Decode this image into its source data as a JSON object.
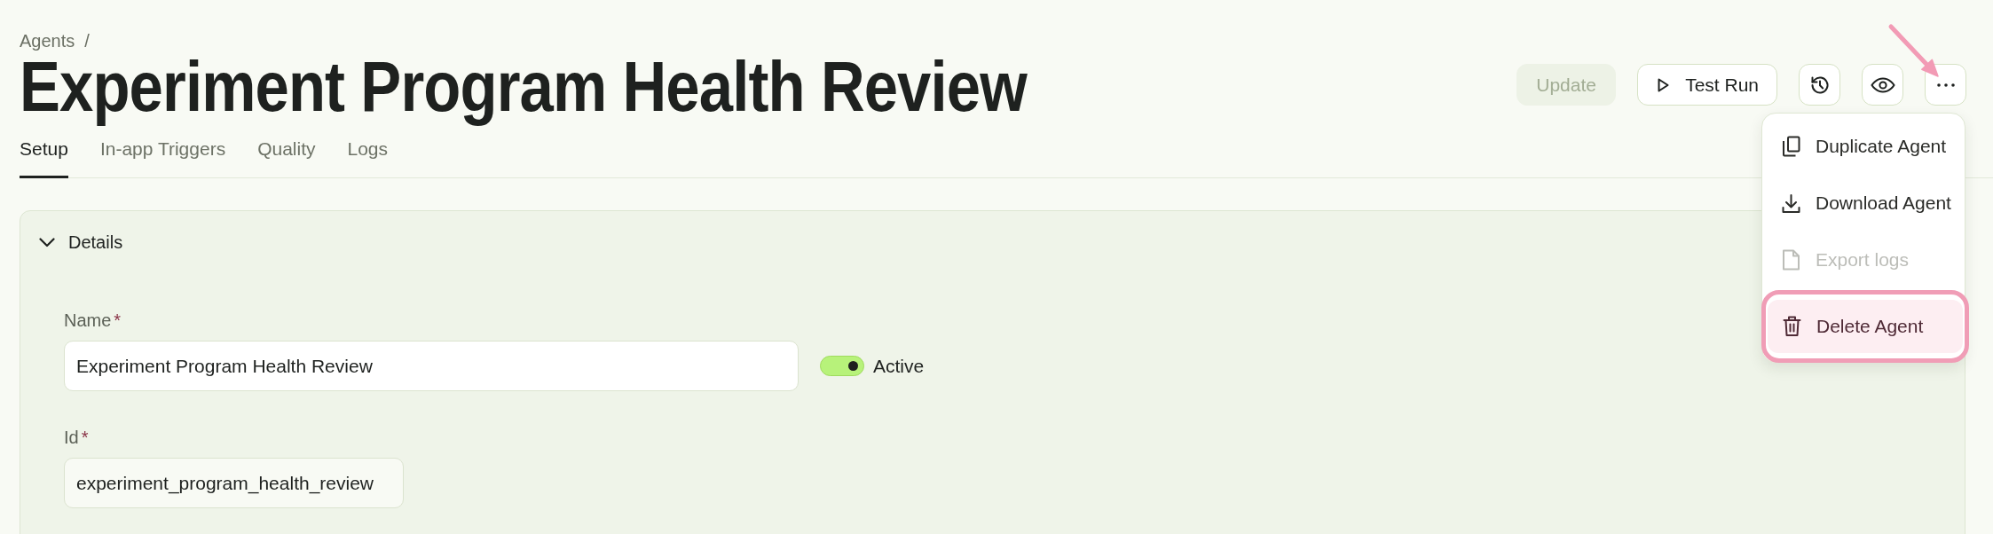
{
  "breadcrumb": {
    "parent": "Agents",
    "separator": "/"
  },
  "title": "Experiment Program Health Review",
  "actions": [
    {
      "kind": "update",
      "label": "Update",
      "disabled": true
    },
    {
      "kind": "run",
      "label": "Test Run",
      "disabled": false
    },
    {
      "kind": "history",
      "disabled": false
    },
    {
      "kind": "preview",
      "disabled": false
    },
    {
      "kind": "more",
      "disabled": false
    }
  ],
  "tabs": [
    {
      "label": "Setup",
      "selected": true
    },
    {
      "label": "In-app Triggers",
      "selected": false
    },
    {
      "label": "Quality",
      "selected": false
    },
    {
      "label": "Logs",
      "selected": false
    }
  ],
  "sections": [
    {
      "title": "Details",
      "expanded": true,
      "fields": [
        {
          "label": "Name",
          "required_mark": "*",
          "value": "Experiment Program Health Review",
          "readonly": false,
          "toggle": {
            "label": "Active",
            "on": true
          }
        },
        {
          "label": "Id",
          "required_mark": "*",
          "value": "experiment_program_health_review",
          "readonly": true
        }
      ]
    }
  ],
  "menu": {
    "open": true,
    "items": [
      {
        "kind": "duplicate",
        "label": "Duplicate Agent",
        "disabled": false,
        "highlighted": false
      },
      {
        "kind": "download",
        "label": "Download Agent",
        "disabled": false,
        "highlighted": false
      },
      {
        "kind": "export",
        "label": "Export logs",
        "disabled": true,
        "highlighted": false
      },
      {
        "kind": "delete",
        "label": "Delete Agent",
        "disabled": false,
        "highlighted": true
      }
    ]
  }
}
